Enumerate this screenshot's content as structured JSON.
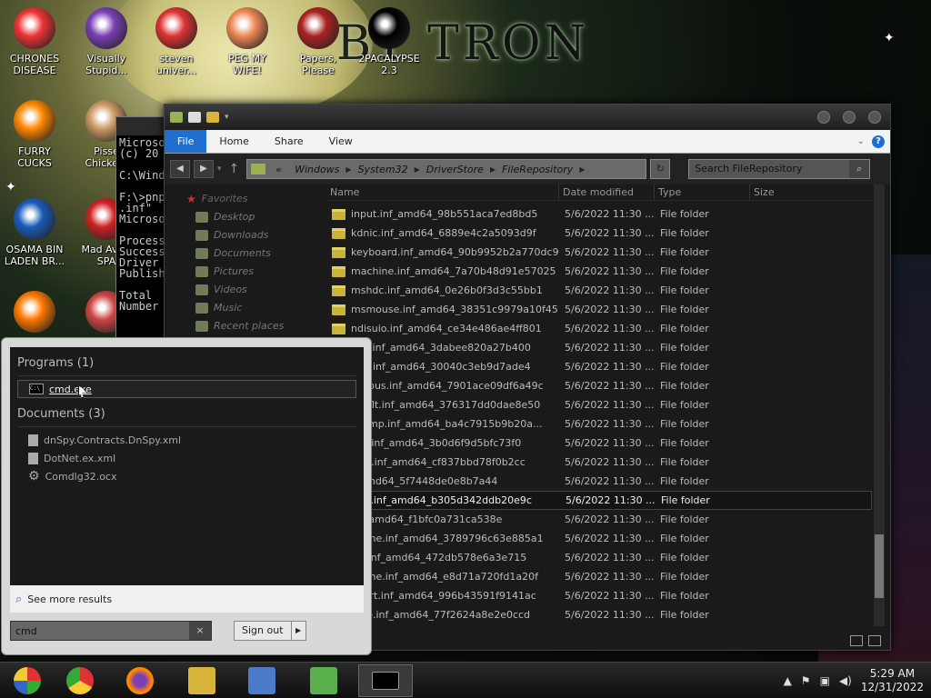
{
  "desktop": {
    "background_text": "BY TRON",
    "icons": [
      {
        "label": "CHRONES DISEASE",
        "color": "#e33"
      },
      {
        "label": "Visually Stupid...",
        "color": "#7a3fb5"
      },
      {
        "label": "steven univer...",
        "color": "#d33"
      },
      {
        "label": "PEG MY WIFE!",
        "color": "#e85"
      },
      {
        "label": "Papers, Please",
        "color": "#a22"
      },
      {
        "label": "2PACALYPSE 2.3",
        "color": "#000"
      },
      {
        "label": "FURRY CUCKS",
        "color": "#f80"
      },
      {
        "label": "Pisse Chicke...",
        "color": "#c96"
      },
      {
        "label": "OSAMA BIN LADEN BR...",
        "color": "#1a5bb8"
      },
      {
        "label": "Mad Av IN SPA",
        "color": "#c22"
      },
      {
        "label": "",
        "color": "#f70"
      },
      {
        "label": "",
        "color": "#c44"
      }
    ]
  },
  "cmd_window": {
    "lines": [
      "Microso",
      "(c) 20",
      "",
      "C:\\Wind",
      "",
      "F:\\>pnp",
      ".inf\"",
      "Microso",
      "",
      "Process",
      "Success",
      "Driver",
      "Publish",
      "",
      "Total",
      "Number"
    ]
  },
  "explorer": {
    "ribbon": {
      "file": "File",
      "home": "Home",
      "share": "Share",
      "view": "View",
      "help": "?"
    },
    "address": [
      "Windows",
      "System32",
      "DriverStore",
      "FileRepository"
    ],
    "address_prefix": "«",
    "search_placeholder": "Search FileRepository",
    "nav": {
      "favorites": "Favorites",
      "items": [
        "Desktop",
        "Downloads",
        "Documents",
        "Pictures",
        "Videos",
        "Music",
        "Recent places"
      ]
    },
    "columns": {
      "name": "Name",
      "date": "Date modified",
      "type": "Type",
      "size": "Size"
    },
    "rows": [
      {
        "name": "input.inf_amd64_98b551aca7ed8bd5",
        "date": "5/6/2022 11:30 ...",
        "type": "File folder"
      },
      {
        "name": "kdnic.inf_amd64_6889e4c2a5093d9f",
        "date": "5/6/2022 11:30 ...",
        "type": "File folder"
      },
      {
        "name": "keyboard.inf_amd64_90b9952b2a770dc9",
        "date": "5/6/2022 11:30 ...",
        "type": "File folder"
      },
      {
        "name": "machine.inf_amd64_7a70b48d91e57025",
        "date": "5/6/2022 11:30 ...",
        "type": "File folder"
      },
      {
        "name": "mshdc.inf_amd64_0e26b0f3d3c55bb1",
        "date": "5/6/2022 11:30 ...",
        "type": "File folder"
      },
      {
        "name": "msmouse.inf_amd64_38351c9979a10f45",
        "date": "5/6/2022 11:30 ...",
        "type": "File folder"
      },
      {
        "name": "ndisuio.inf_amd64_ce34e486ae4ff801",
        "date": "5/6/2022 11:30 ...",
        "type": "File folder"
      },
      {
        "name": "c64.inf_amd64_3dabee820a27b400",
        "date": "5/6/2022 11:30 ...",
        "type": "File folder"
      },
      {
        "name": "x64.inf_amd64_30040c3eb9d7ade4",
        "date": "5/6/2022 11:30 ...",
        "type": "File folder"
      },
      {
        "name": "wifibus.inf_amd64_7901ace09df6a49c",
        "date": "5/6/2022 11:30 ...",
        "type": "File folder"
      },
      {
        "name": "wififlt.inf_amd64_376317dd0dae8e50",
        "date": "5/6/2022 11:30 ...",
        "type": "File folder"
      },
      {
        "name": "wifimp.inf_amd64_ba4c7915b9b20a...",
        "date": "5/6/2022 11:30 ...",
        "type": "File folder"
      },
      {
        "name": "trig.inf_amd64_3b0d6f9d5bfc73f0",
        "date": "5/6/2022 11:30 ...",
        "type": "File folder"
      },
      {
        "name": "disk.inf_amd64_cf837bbd78f0b2cc",
        "date": "5/6/2022 11:30 ...",
        "type": "File folder"
      },
      {
        "name": "f_amd64_5f7448de0e8b7a44",
        "date": "5/6/2022 11:30 ...",
        "type": "File folder"
      },
      {
        "name": "k64.inf_amd64_b305d342ddb20e9c",
        "date": "5/6/2022 11:30 ...",
        "type": "File folder",
        "selected": true
      },
      {
        "name": "inf_amd64_f1bfc0a731ca538e",
        "date": "5/6/2022 11:30 ...",
        "type": "File folder"
      },
      {
        "name": "olume.inf_amd64_3789796c63e885a1",
        "date": "5/6/2022 11:30 ...",
        "type": "File folder"
      },
      {
        "name": "isk.inf_amd64_472db578e6a3e715",
        "date": "5/6/2022 11:30 ...",
        "type": "File folder"
      },
      {
        "name": "olume.inf_amd64_e8d71a720fd1a20f",
        "date": "5/6/2022 11:30 ...",
        "type": "File folder"
      },
      {
        "name": "eport.inf_amd64_996b43591f9141ac",
        "date": "5/6/2022 11:30 ...",
        "type": "File folder"
      },
      {
        "name": "vme.inf_amd64_77f2624a8e2e0ccd",
        "date": "5/6/2022 11:30 ...",
        "type": "File folder"
      }
    ]
  },
  "start_menu": {
    "programs_heading": "Programs (1)",
    "programs": [
      "cmd.exe"
    ],
    "documents_heading": "Documents (3)",
    "documents": [
      {
        "name": "dnSpy.Contracts.DnSpy.xml",
        "icon": "document-icon"
      },
      {
        "name": "DotNet.ex.xml",
        "icon": "document-icon"
      },
      {
        "name": "Comdlg32.ocx",
        "icon": "gear-icon"
      }
    ],
    "see_more": "See more results",
    "search_value": "cmd",
    "search_clear": "×",
    "sign_out": "Sign out",
    "sign_out_arrow": "▶"
  },
  "taskbar": {
    "time": "5:29 AM",
    "date": "12/31/2022"
  }
}
